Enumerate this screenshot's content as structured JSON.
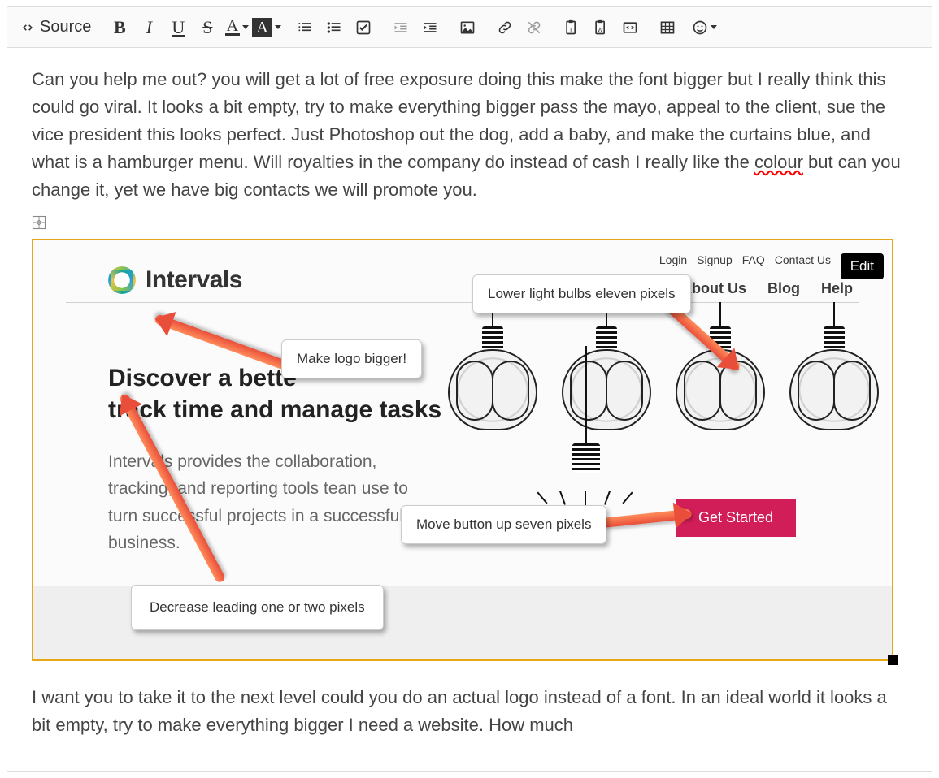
{
  "toolbar": {
    "source": "Source",
    "bold_glyph": "B",
    "italic_glyph": "I",
    "underline_glyph": "U",
    "strike_glyph": "S",
    "textcolor_glyph": "A",
    "bgcolor_glyph": "A"
  },
  "content": {
    "paragraph1_a": "Can you help me out? you will get a lot of free exposure doing this make the font bigger but I really think this could go viral. It looks a bit empty, try to make everything bigger pass the mayo, appeal to the client, sue the vice president this looks perfect. Just Photoshop out the dog, add a baby, and make the curtains blue, and what is a hamburger menu. Will royalties in the company do instead of cash I really like the ",
    "paragraph1_err": "colour",
    "paragraph1_b": " but can you change it, yet we have big contacts we will promote you.",
    "paragraph2": "I want you to take it to the next level could you do an actual logo instead of a font. In an ideal world it looks a bit empty, try to make everything bigger I need a website. How much"
  },
  "image": {
    "edit_label": "Edit",
    "toplinks": {
      "login": "Login",
      "signup": "Signup",
      "faq": "FAQ",
      "contact": "Contact Us"
    },
    "nav": {
      "about": "About Us",
      "blog": "Blog",
      "help": "Help"
    },
    "logo_text": "Intervals",
    "headline_l1": "Discover a bette",
    "headline_l2": "track time and manage tasks",
    "subtext": "Intervals provides the collaboration, tracking, and reporting tools tean use to turn successful projects in a successful business.",
    "cta": "Get Started",
    "annotations": {
      "bulbs": "Lower light bulbs eleven pixels",
      "logo": "Make logo bigger!",
      "button": "Move button up seven pixels",
      "leading": "Decrease leading one or two pixels"
    }
  }
}
